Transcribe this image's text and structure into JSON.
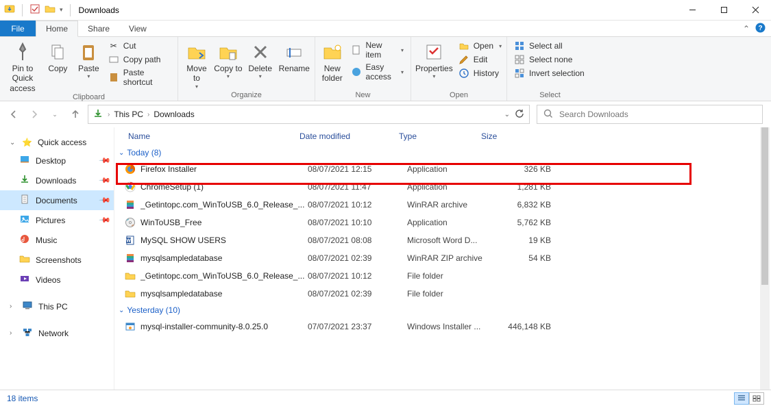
{
  "window": {
    "title": "Downloads"
  },
  "ribbon_tabs": {
    "file": "File",
    "home": "Home",
    "share": "Share",
    "view": "View"
  },
  "ribbon": {
    "pin_quick": "Pin to Quick access",
    "copy": "Copy",
    "paste": "Paste",
    "cut": "Cut",
    "copy_path": "Copy path",
    "paste_shortcut": "Paste shortcut",
    "clipboard_group": "Clipboard",
    "move_to": "Move to",
    "copy_to": "Copy to",
    "delete": "Delete",
    "rename": "Rename",
    "organize_group": "Organize",
    "new_folder": "New folder",
    "new_item": "New item",
    "easy_access": "Easy access",
    "new_group": "New",
    "properties": "Properties",
    "open": "Open",
    "edit": "Edit",
    "history": "History",
    "open_group": "Open",
    "select_all": "Select all",
    "select_none": "Select none",
    "invert_selection": "Invert selection",
    "select_group": "Select"
  },
  "breadcrumb": {
    "root": "This PC",
    "current": "Downloads"
  },
  "search": {
    "placeholder": "Search Downloads"
  },
  "sidebar": {
    "quick_access": "Quick access",
    "desktop": "Desktop",
    "downloads": "Downloads",
    "documents": "Documents",
    "pictures": "Pictures",
    "music": "Music",
    "screenshots": "Screenshots",
    "videos": "Videos",
    "this_pc": "This PC",
    "network": "Network"
  },
  "columns": {
    "name": "Name",
    "date": "Date modified",
    "type": "Type",
    "size": "Size"
  },
  "groups": {
    "today": {
      "label": "Today (8)"
    },
    "yesterday": {
      "label": "Yesterday (10)"
    }
  },
  "files": {
    "today": [
      {
        "name": "Firefox Installer",
        "date": "08/07/2021 12:15",
        "type": "Application",
        "size": "326 KB",
        "icon": "firefox"
      },
      {
        "name": "ChromeSetup (1)",
        "date": "08/07/2021 11:47",
        "type": "Application",
        "size": "1,281 KB",
        "icon": "chrome"
      },
      {
        "name": "_Getintopc.com_WinToUSB_6.0_Release_...",
        "date": "08/07/2021 10:12",
        "type": "WinRAR archive",
        "size": "6,832 KB",
        "icon": "rar"
      },
      {
        "name": "WinToUSB_Free",
        "date": "08/07/2021 10:10",
        "type": "Application",
        "size": "5,762 KB",
        "icon": "disc"
      },
      {
        "name": "MySQL SHOW USERS",
        "date": "08/07/2021 08:08",
        "type": "Microsoft Word D...",
        "size": "19 KB",
        "icon": "word"
      },
      {
        "name": "mysqlsampledatabase",
        "date": "08/07/2021 02:39",
        "type": "WinRAR ZIP archive",
        "size": "54 KB",
        "icon": "rar"
      },
      {
        "name": "_Getintopc.com_WinToUSB_6.0_Release_...",
        "date": "08/07/2021 10:12",
        "type": "File folder",
        "size": "",
        "icon": "folder"
      },
      {
        "name": "mysqlsampledatabase",
        "date": "08/07/2021 02:39",
        "type": "File folder",
        "size": "",
        "icon": "folder"
      }
    ],
    "yesterday": [
      {
        "name": "mysql-installer-community-8.0.25.0",
        "date": "07/07/2021 23:37",
        "type": "Windows Installer ...",
        "size": "446,148 KB",
        "icon": "msi"
      }
    ]
  },
  "status": {
    "item_count": "18 items"
  }
}
